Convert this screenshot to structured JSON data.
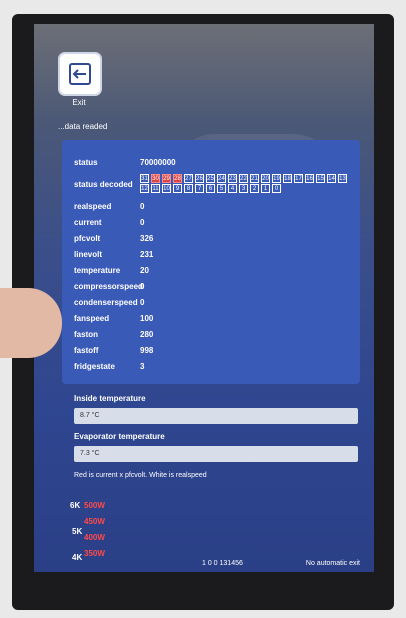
{
  "exit": {
    "label": "Exit"
  },
  "status_line": "...data readed",
  "params": [
    {
      "label": "status",
      "value": "70000000"
    },
    {
      "label": "status decoded",
      "value": ""
    },
    {
      "label": "realspeed",
      "value": "0"
    },
    {
      "label": "current",
      "value": "0"
    },
    {
      "label": "pfcvolt",
      "value": "326"
    },
    {
      "label": "linevolt",
      "value": "231"
    },
    {
      "label": "temperature",
      "value": "20"
    },
    {
      "label": "compressorspeed",
      "value": "0"
    },
    {
      "label": "condenserspeed",
      "value": "0"
    },
    {
      "label": "fanspeed",
      "value": "100"
    },
    {
      "label": "faston",
      "value": "280"
    },
    {
      "label": "fastoff",
      "value": "998"
    },
    {
      "label": "fridgestate",
      "value": "3"
    }
  ],
  "bits_row1": [
    "31",
    "30",
    "29",
    "28",
    "27",
    "26",
    "25",
    "24",
    "23",
    "22",
    "21",
    "20",
    "19",
    "18",
    "17",
    "16",
    "15",
    "14",
    "13"
  ],
  "bits_row1_red": [
    1,
    2,
    3
  ],
  "bits_row2": [
    "12",
    "11",
    "10",
    "9",
    "8",
    "7",
    "6",
    "5",
    "4",
    "3",
    "2",
    "1",
    "0"
  ],
  "inside": {
    "label": "Inside temperature",
    "value": "8.7 °C"
  },
  "evaporator": {
    "label": "Evaporator temperature",
    "value": "7.3 °C"
  },
  "note": "Red is current x pfcvolt. White is realspeed",
  "chart_data": {
    "type": "line",
    "title": "",
    "y_white_ticks": [
      "6K",
      "5K",
      "4K"
    ],
    "y_red_ticks": [
      "500W",
      "450W",
      "400W",
      "350W"
    ]
  },
  "footer": {
    "center": "1 0 0 131456",
    "right": "No automatic exit"
  },
  "colors": {
    "panel": "#3a5ab8",
    "red": "#ff4a4a"
  }
}
